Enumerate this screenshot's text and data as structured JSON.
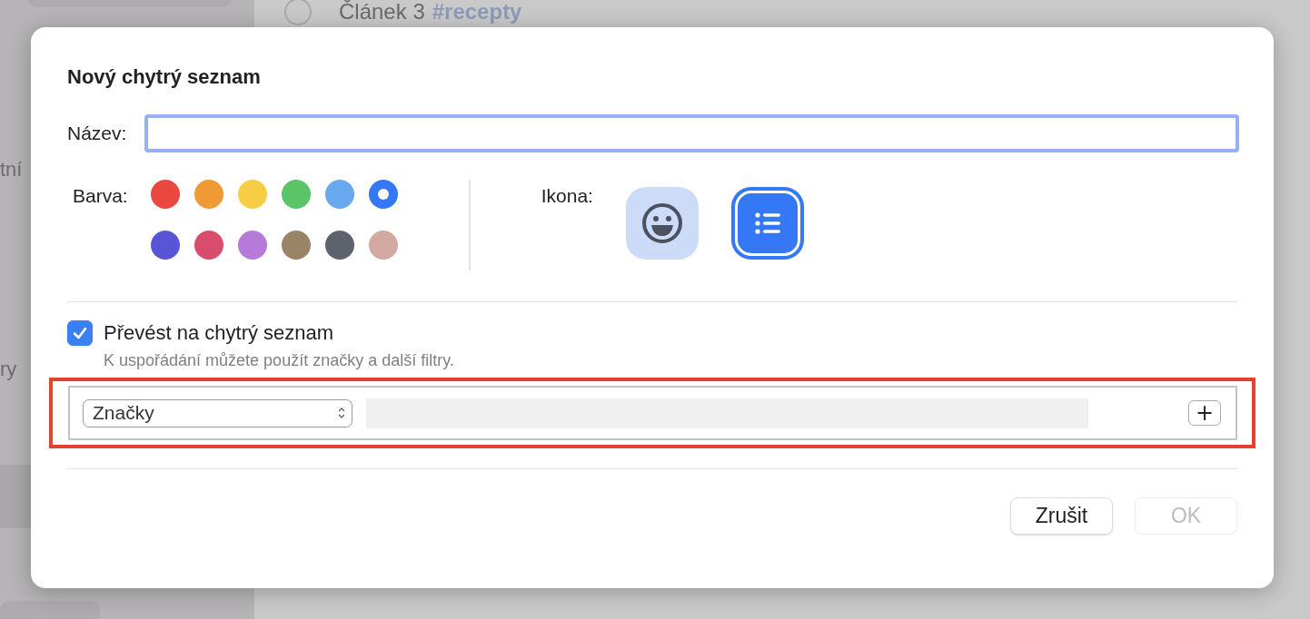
{
  "background": {
    "sidebar_fragments": [
      "tní",
      "ry"
    ],
    "list_row": {
      "title": "Článek 3",
      "tag": "#recepty",
      "checked": false
    }
  },
  "dialog": {
    "title": "Nový chytrý seznam",
    "name_field": {
      "label": "Název:"
    },
    "color_label": "Barva:",
    "colors": [
      {
        "color": "#e8483e",
        "selected": false
      },
      {
        "color": "#f09a36",
        "selected": false
      },
      {
        "color": "#f7cd46",
        "selected": false
      },
      {
        "color": "#5bc466",
        "selected": false
      },
      {
        "color": "#68a8ee",
        "selected": false
      },
      {
        "color": "#3478f6",
        "selected": true
      },
      {
        "color": "#5856d6",
        "selected": false
      },
      {
        "color": "#da4c6c",
        "selected": false
      },
      {
        "color": "#b67ad9",
        "selected": false
      },
      {
        "color": "#998468",
        "selected": false
      },
      {
        "color": "#5c636c",
        "selected": false
      },
      {
        "color": "#d2a8a0",
        "selected": false
      }
    ],
    "icon_label": "Ikona:",
    "icons": [
      {
        "kind": "emoji",
        "selected": false
      },
      {
        "kind": "list",
        "selected": true
      }
    ],
    "smart_list": {
      "label": "Převést na chytrý seznam",
      "checked": true,
      "hint": "K uspořádání můžete použít značky a další filtry."
    },
    "rule_editor": {
      "highlighted": true,
      "filter": "Značky",
      "add": "+"
    },
    "buttons": [
      {
        "label": "Zrušit",
        "disabled": false
      },
      {
        "label": "OK",
        "disabled": true
      }
    ]
  }
}
